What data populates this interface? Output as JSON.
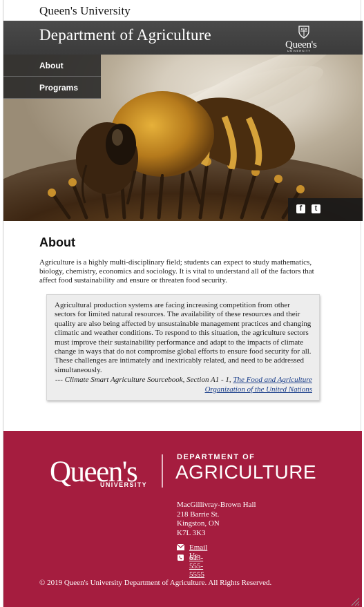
{
  "university": {
    "name": "Queen's University"
  },
  "department": {
    "title": "Department of Agriculture",
    "crest_word": "Queen's",
    "crest_sub": "UNIVERSITY"
  },
  "nav": {
    "items": [
      {
        "label": "About"
      },
      {
        "label": "Programs"
      }
    ]
  },
  "social": {
    "icons": [
      "facebook-icon",
      "twitter-icon"
    ]
  },
  "main": {
    "heading": "About",
    "intro": "Agriculture is a highly multi-disciplinary field; students can expect to study mathematics, biology, chemistry, economics and sociology. It is vital to understand all of the factors that affect food sustainability and ensure or threaten food security.",
    "quote": {
      "text": "Agricultural production systems are facing increasing competition from other sectors for limited natural resources. The availability of these resources and their quality are also being affected by unsustainable management practices and changing climatic and weather conditions. To respond to this situation, the agriculture sectors must improve their sustainability performance and adapt to the impacts of climate change in ways that do not compromise global efforts to ensure food security for all. These challenges are intimately and inextricably related, and need to be addressed simultaneously.",
      "cite_prefix": "--- Climate Smart Agriculture Sourcebook, Section A1 - 1,",
      "cite_link": "The Food and Agriculture Organization of the United Nations"
    }
  },
  "footer": {
    "logo_queens": "Queen's",
    "logo_university": "UNIVERSITY",
    "logo_dept_of": "DEPARTMENT OF",
    "logo_agriculture": "AGRICULTURE",
    "address": [
      "MacGillivray-Brown Hall",
      "218 Barrie St.",
      "Kingston, ON",
      "K7L 3K3"
    ],
    "email_label": "Email Us",
    "phone": "613-555-5555",
    "copyright": "© 2019 Queen's University Department of Agriculture. All Rights Reserved."
  },
  "colors": {
    "footer_bg": "#a51d3f",
    "dept_bar": "#424242",
    "link": "#1a3e8a"
  }
}
